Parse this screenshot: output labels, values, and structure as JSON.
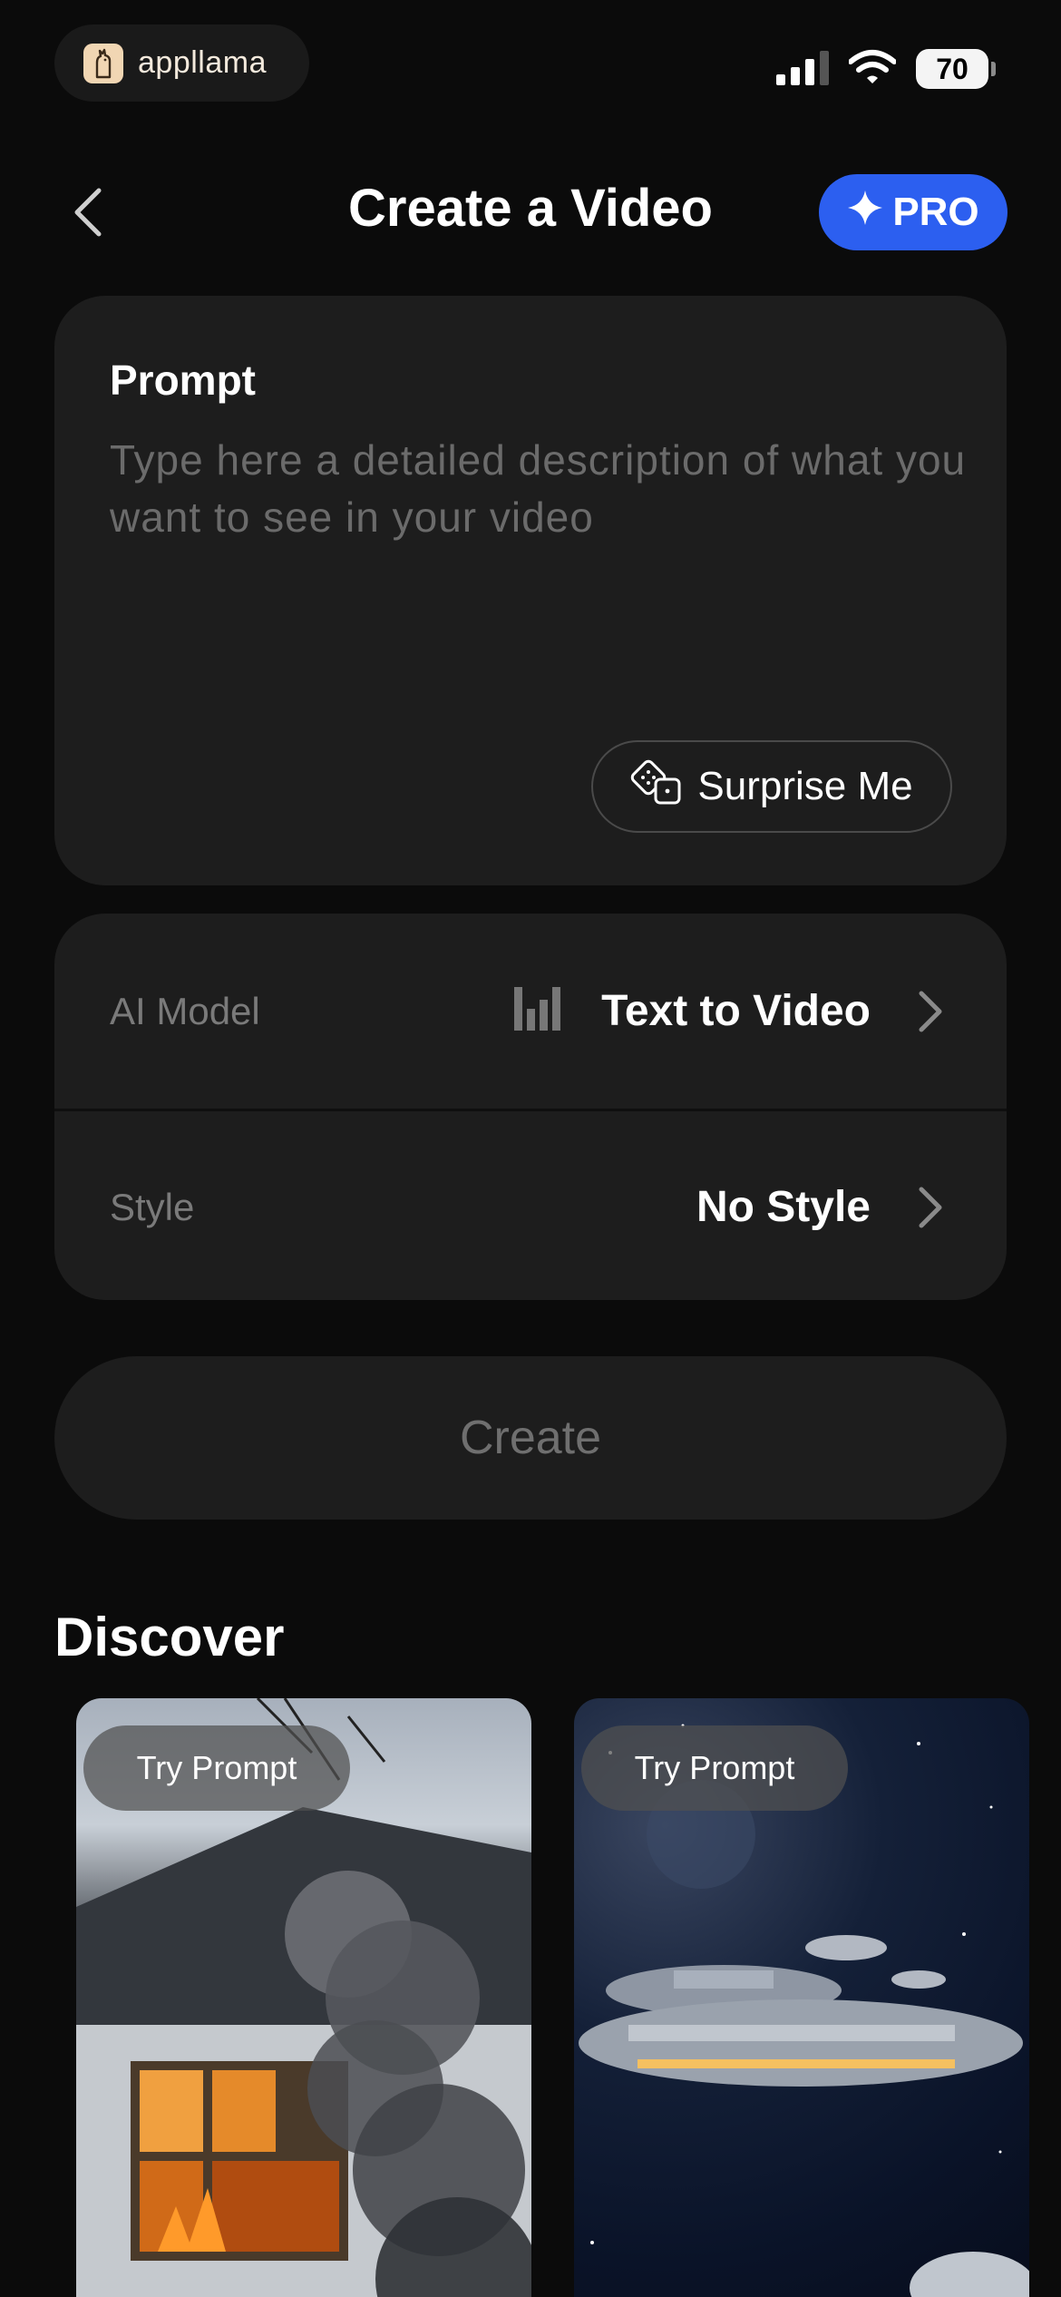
{
  "status_bar": {
    "brand_name": "appllama",
    "battery_level": "70"
  },
  "header": {
    "title": "Create a Video",
    "pro_label": "PRO"
  },
  "prompt": {
    "label": "Prompt",
    "value": "",
    "placeholder": "Type here a detailed description of what you want to see in your video",
    "surprise_label": "Surprise Me"
  },
  "settings": {
    "model_label": "AI Model",
    "model_value": "Text to Video",
    "style_label": "Style",
    "style_value": "No Style"
  },
  "create_label": "Create",
  "discover": {
    "title": "Discover",
    "cards": [
      {
        "badge": "Try Prompt"
      },
      {
        "badge": "Try Prompt"
      }
    ]
  },
  "colors": {
    "background": "#0b0b0b",
    "card": "#1d1d1d",
    "accent": "#2c5ff0",
    "muted_text": "#7a7a7a"
  },
  "icons": [
    "back-chevron-icon",
    "sparkle-icon",
    "dice-icon",
    "model-bars-icon",
    "chevron-right-icon",
    "signal-icon",
    "wifi-icon",
    "battery-icon",
    "llama-logo-icon"
  ]
}
